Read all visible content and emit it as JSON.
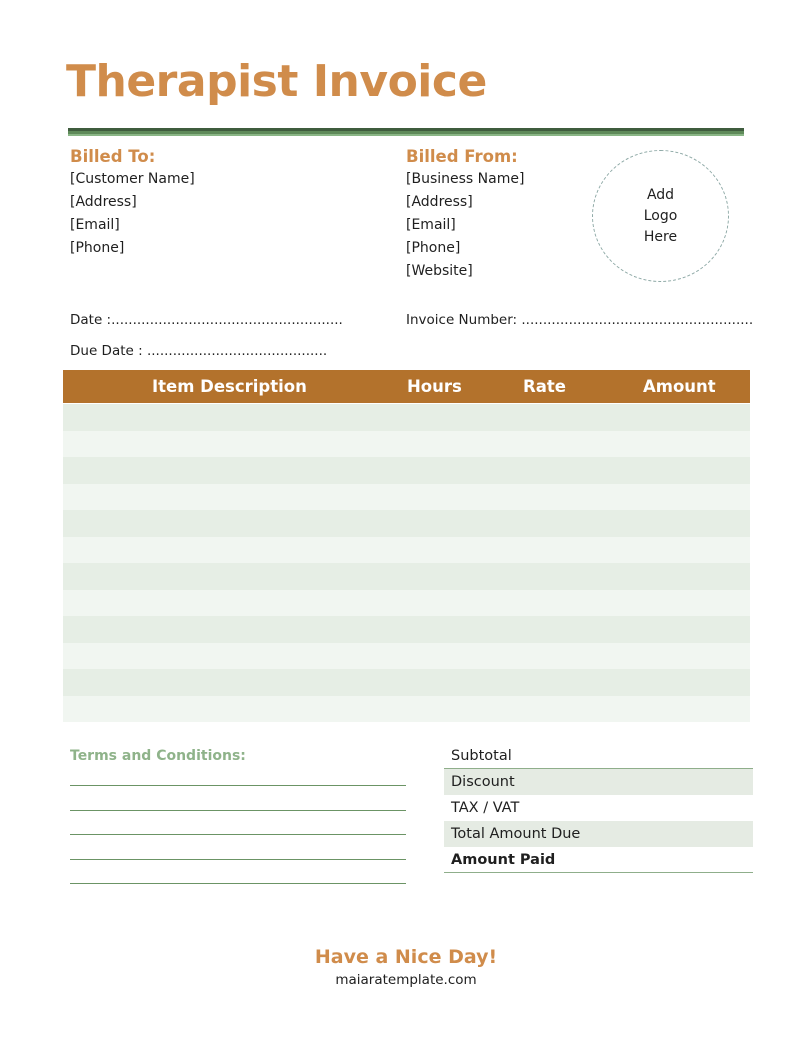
{
  "document": {
    "title": "Therapist Invoice"
  },
  "billed_to": {
    "heading": "Billed To:",
    "fields": [
      "[Customer Name]",
      "[Address]",
      "[Email]",
      "[Phone]"
    ]
  },
  "billed_from": {
    "heading": "Billed From:",
    "fields": [
      "[Business Name]",
      "[Address]",
      "[Email]",
      "[Phone]",
      "[Website]"
    ]
  },
  "logo": {
    "lines": [
      "Add",
      "Logo",
      "Here"
    ]
  },
  "meta": {
    "date": "Date :......................................................",
    "due_date": "Due Date : ..........................................",
    "invoice_number": "Invoice Number: ......................................................"
  },
  "table": {
    "headers": [
      "Item Description",
      "Hours",
      "Rate",
      "Amount"
    ],
    "rows": [
      [
        "",
        "",
        "",
        ""
      ],
      [
        "",
        "",
        "",
        ""
      ],
      [
        "",
        "",
        "",
        ""
      ],
      [
        "",
        "",
        "",
        ""
      ],
      [
        "",
        "",
        "",
        ""
      ],
      [
        "",
        "",
        "",
        ""
      ],
      [
        "",
        "",
        "",
        ""
      ],
      [
        "",
        "",
        "",
        ""
      ],
      [
        "",
        "",
        "",
        ""
      ],
      [
        "",
        "",
        "",
        ""
      ],
      [
        "",
        "",
        "",
        ""
      ],
      [
        "",
        "",
        "",
        ""
      ]
    ]
  },
  "terms": {
    "heading": "Terms and Conditions:",
    "line_count": 5
  },
  "totals": {
    "subtotal": "Subtotal",
    "discount": "Discount",
    "tax": "TAX / VAT",
    "total_due": "Total Amount Due",
    "amount_paid": "Amount Paid"
  },
  "footer": {
    "message": "Have a Nice Day!",
    "site": "maiaratemplate.com"
  },
  "colors": {
    "accent_orange": "#d08c4b",
    "header_brown": "#b3722c",
    "green_dark": "#3f5c3e",
    "green_light": "#8ab686",
    "row_shade": "#e6eee5"
  }
}
